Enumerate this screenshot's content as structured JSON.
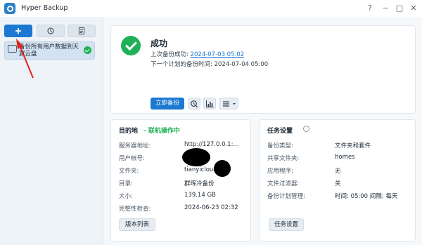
{
  "app": {
    "title": "Hyper Backup",
    "window_controls": [
      "?",
      "−",
      "□",
      "✕"
    ]
  },
  "sidebar": {
    "buttons": [
      {
        "icon": "plus-icon"
      },
      {
        "icon": "history-icon"
      },
      {
        "icon": "log-icon"
      }
    ],
    "task": {
      "label": "备份所有用户数据到天翼云盘",
      "status": "ok"
    }
  },
  "status": {
    "title": "成功",
    "last_backup_label": "上次备份成功: ",
    "last_backup_time": "2024-07-03 05:02",
    "next_backup": "下一个计划的备份时间: 2024-07-04 05:00",
    "backup_now_label": "立即备份"
  },
  "destination": {
    "title": "目的地",
    "status": "- 联机操作中",
    "rows": [
      {
        "label": "服务器地址:",
        "value": "http://127.0.0.1:..."
      },
      {
        "label": "用户帐号:",
        "value": ""
      },
      {
        "label": "文件夹:",
        "value": "tianyicloud"
      },
      {
        "label": "目录:",
        "value": "群晖冷备份"
      },
      {
        "label": "大小:",
        "value": "139.14 GB"
      },
      {
        "label": "完整性检查:",
        "value": "2024-06-23 02:32"
      }
    ],
    "button_label": "版本列表"
  },
  "task_settings": {
    "title": "任务设置",
    "rows": [
      {
        "label": "备份类型:",
        "value": "文件夹和套件"
      },
      {
        "label": "共享文件夹:",
        "value": "homes"
      },
      {
        "label": "应用程序:",
        "value": "无"
      },
      {
        "label": "文件过滤器:",
        "value": "关"
      },
      {
        "label": "备份计划管理:",
        "value": "时间: 05:00 间隔: 每天"
      }
    ],
    "button_label": "任务设置"
  },
  "colors": {
    "accent": "#1c78d1",
    "success": "#1fb156",
    "annotation": "#e02020"
  }
}
